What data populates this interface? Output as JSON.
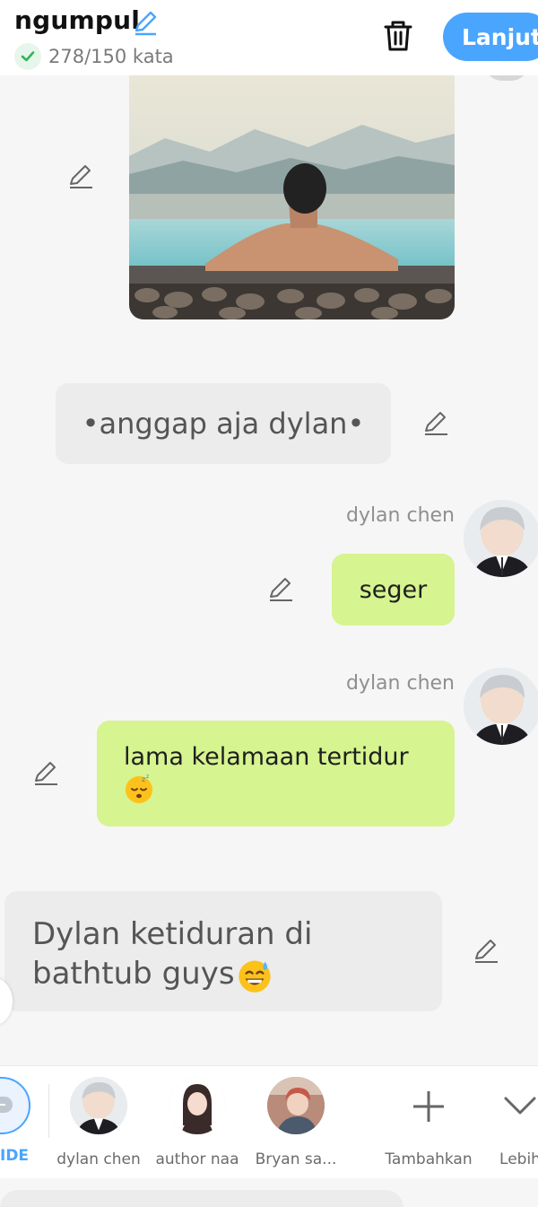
{
  "header": {
    "title": "ngumpul",
    "word_count": "278/150 kata",
    "next_label": "Lanjut"
  },
  "messages": {
    "narration_1": "•anggap aja dylan•",
    "msg_1": {
      "sender": "dylan chen",
      "text": "seger"
    },
    "msg_2": {
      "sender": "dylan chen",
      "text": "lama kelamaan tertidur"
    },
    "narration_2": "Dylan ketiduran di bathtub guys"
  },
  "character_bar": {
    "guide_label": "IDE",
    "characters": [
      {
        "name": "dylan chen"
      },
      {
        "name": "author naa"
      },
      {
        "name": "Bryan sa..."
      }
    ],
    "add_label": "Tambahkan",
    "more_label": "Lebih"
  },
  "colors": {
    "accent": "#4aa5ff",
    "green_bubble": "#d6f48f",
    "narration_bubble": "#ececec"
  }
}
